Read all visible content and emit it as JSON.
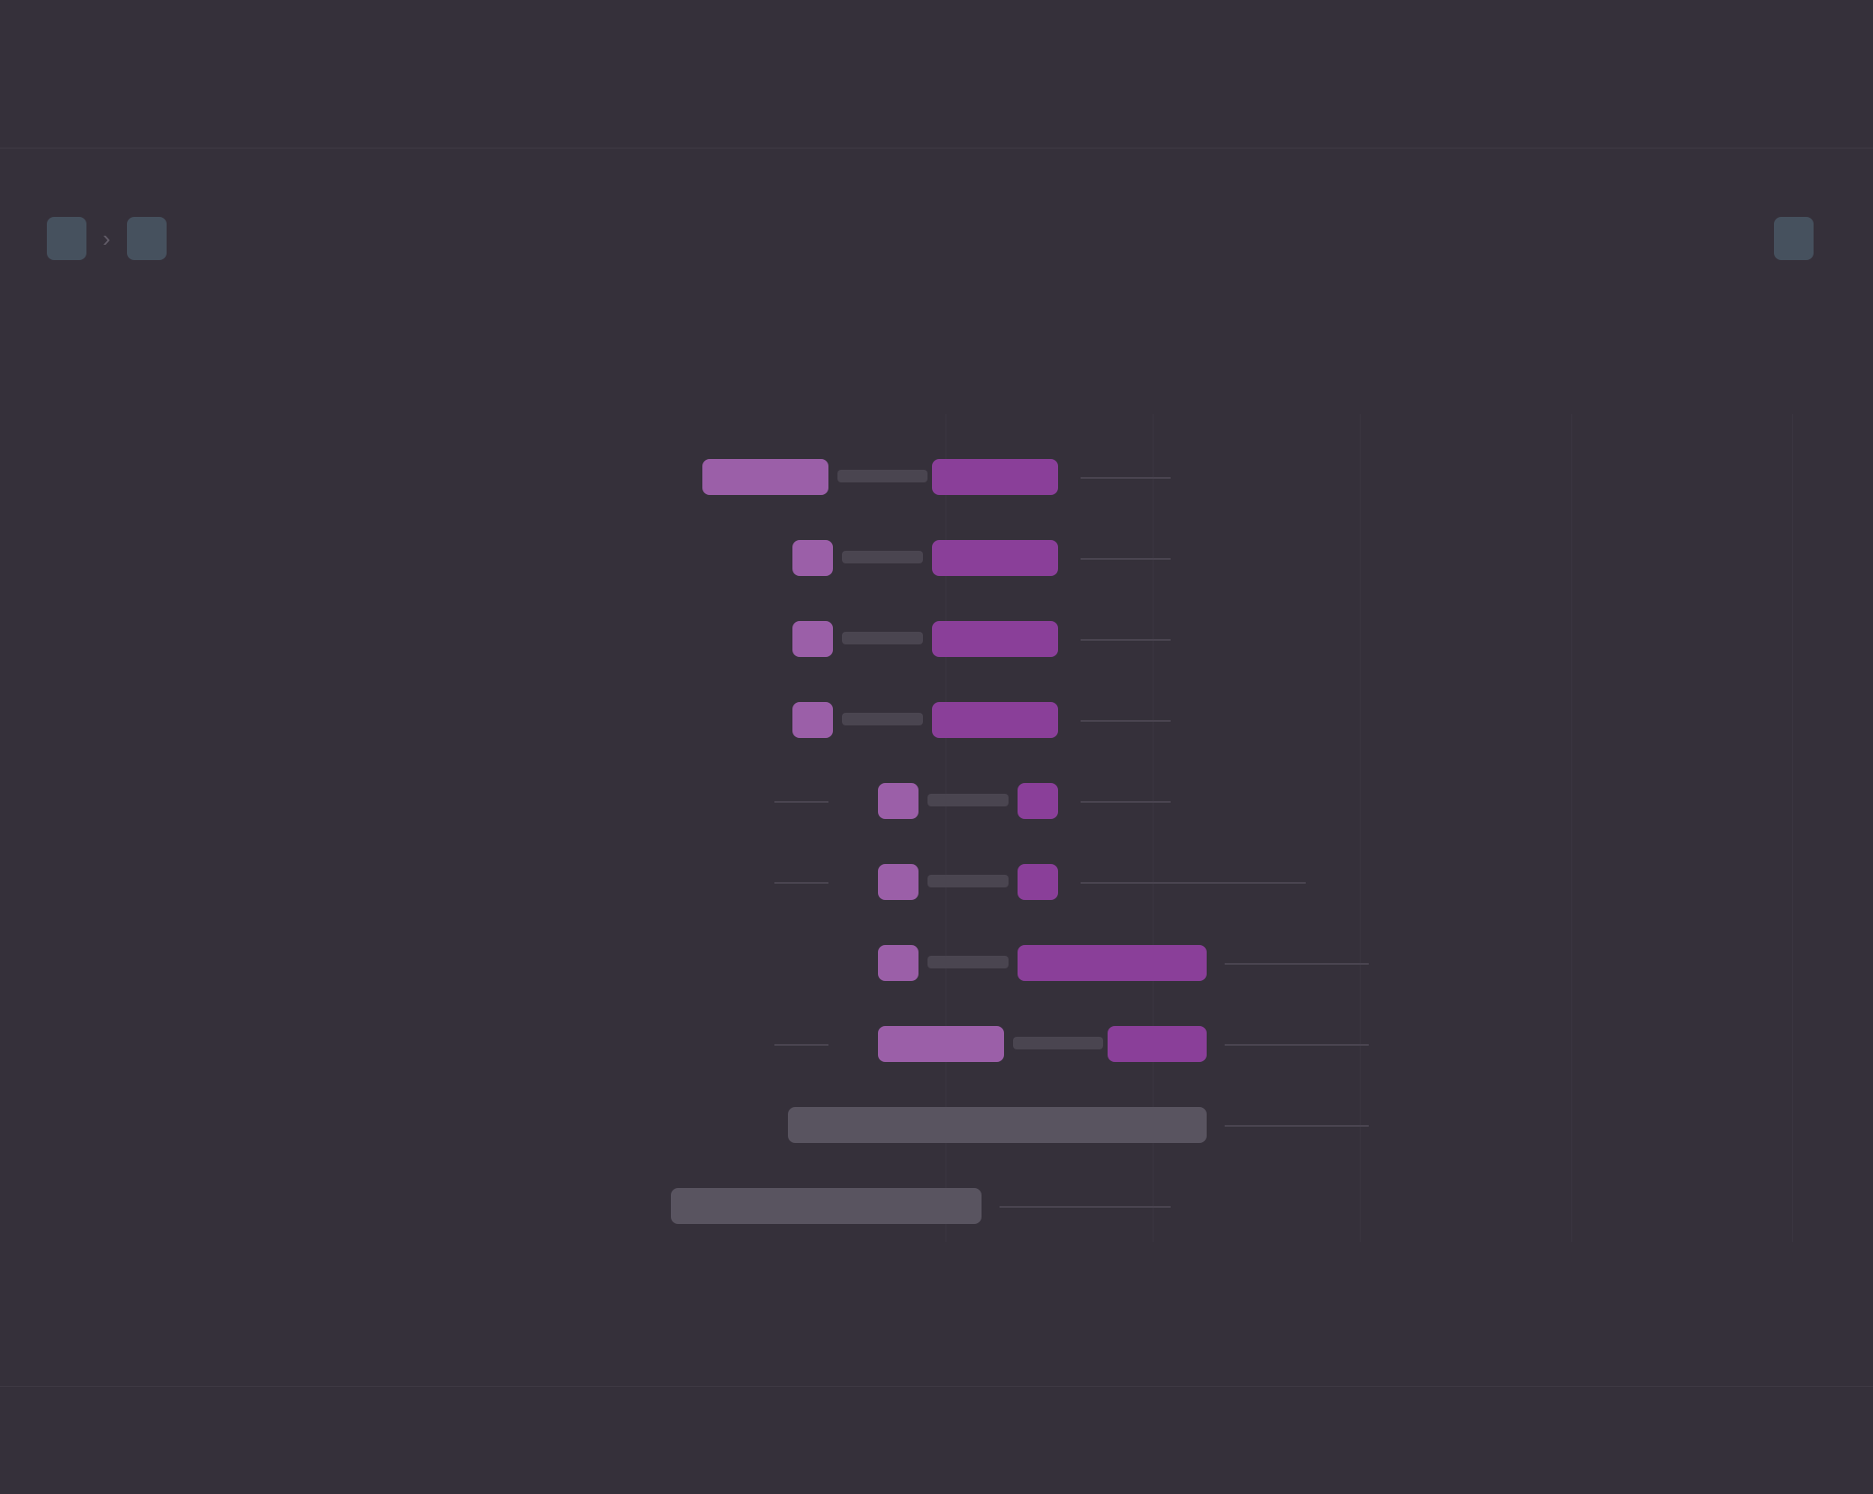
{
  "app": {
    "title": ""
  },
  "toolbar": {
    "primary_pill": "",
    "secondary_pill": "",
    "secondary_meta": "",
    "right_meta": "",
    "right_pill": "",
    "right_trailing": ""
  },
  "timeline": {
    "top_ticks": [
      "",
      "",
      "",
      "",
      ""
    ],
    "bottom_ticks": [
      "",
      "",
      "",
      "",
      ""
    ],
    "rows": [
      {
        "label": "",
        "value": ""
      },
      {
        "label": "",
        "value": ""
      },
      {
        "label": "",
        "value": ""
      },
      {
        "label": "",
        "value": ""
      },
      {
        "label": "",
        "value": ""
      },
      {
        "label": "",
        "value": ""
      },
      {
        "label": "",
        "value": ""
      },
      {
        "label": "",
        "value": ""
      },
      {
        "label": "",
        "value": ""
      },
      {
        "label": "",
        "value": ""
      }
    ]
  },
  "footer": {
    "items": [
      "",
      "",
      "",
      ""
    ],
    "badge": "",
    "links": [
      "",
      ""
    ]
  },
  "colors": {
    "background": "#35303a",
    "bar_light": "#9b5fa8",
    "bar_dark": "#8a3f99",
    "pill": "#46515e",
    "link": "#8a4f99"
  }
}
